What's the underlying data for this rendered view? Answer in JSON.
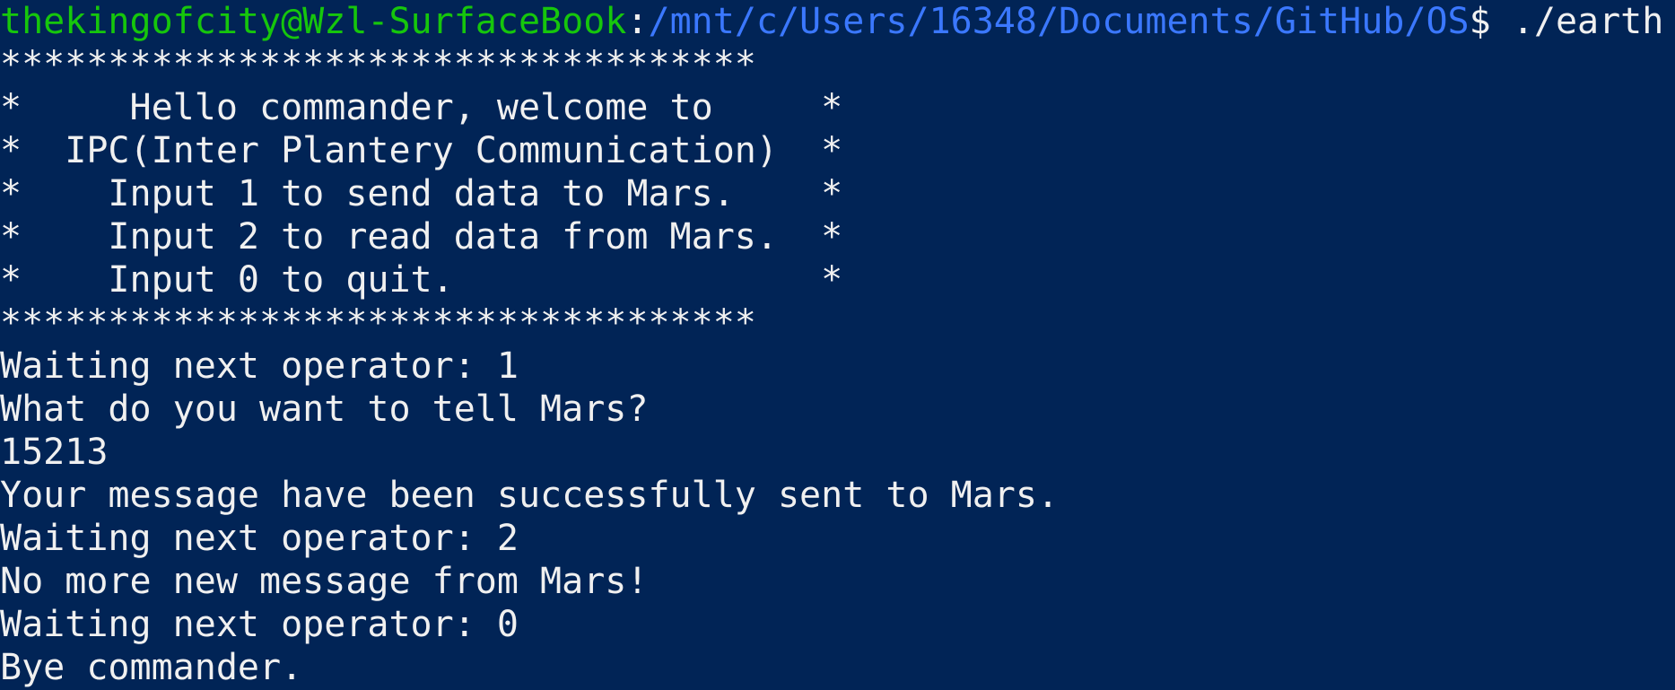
{
  "colors": {
    "background": "#012456",
    "text": "#f0f0f0",
    "user_host": "#16c60c",
    "path": "#3b78ff"
  },
  "prompt": {
    "user_host": "thekingofcity@Wzl-SurfaceBook",
    "separator": ":",
    "path": "/mnt/c/Users/16348/Documents/GitHub/OS",
    "sign_and_command": "$ ./earth"
  },
  "banner": [
    "***********************************",
    "*     Hello commander, welcome to     *",
    "*  IPC(Inter Plantery Communication)  *",
    "*    Input 1 to send data to Mars.    *",
    "*    Input 2 to read data from Mars.  *",
    "*    Input 0 to quit.                 *",
    "***********************************"
  ],
  "session": [
    "Waiting next operator: 1",
    "What do you want to tell Mars?",
    "15213",
    "Your message have been successfully sent to Mars.",
    "Waiting next operator: 2",
    "No more new message from Mars!",
    "Waiting next operator: 0",
    "Bye commander."
  ]
}
